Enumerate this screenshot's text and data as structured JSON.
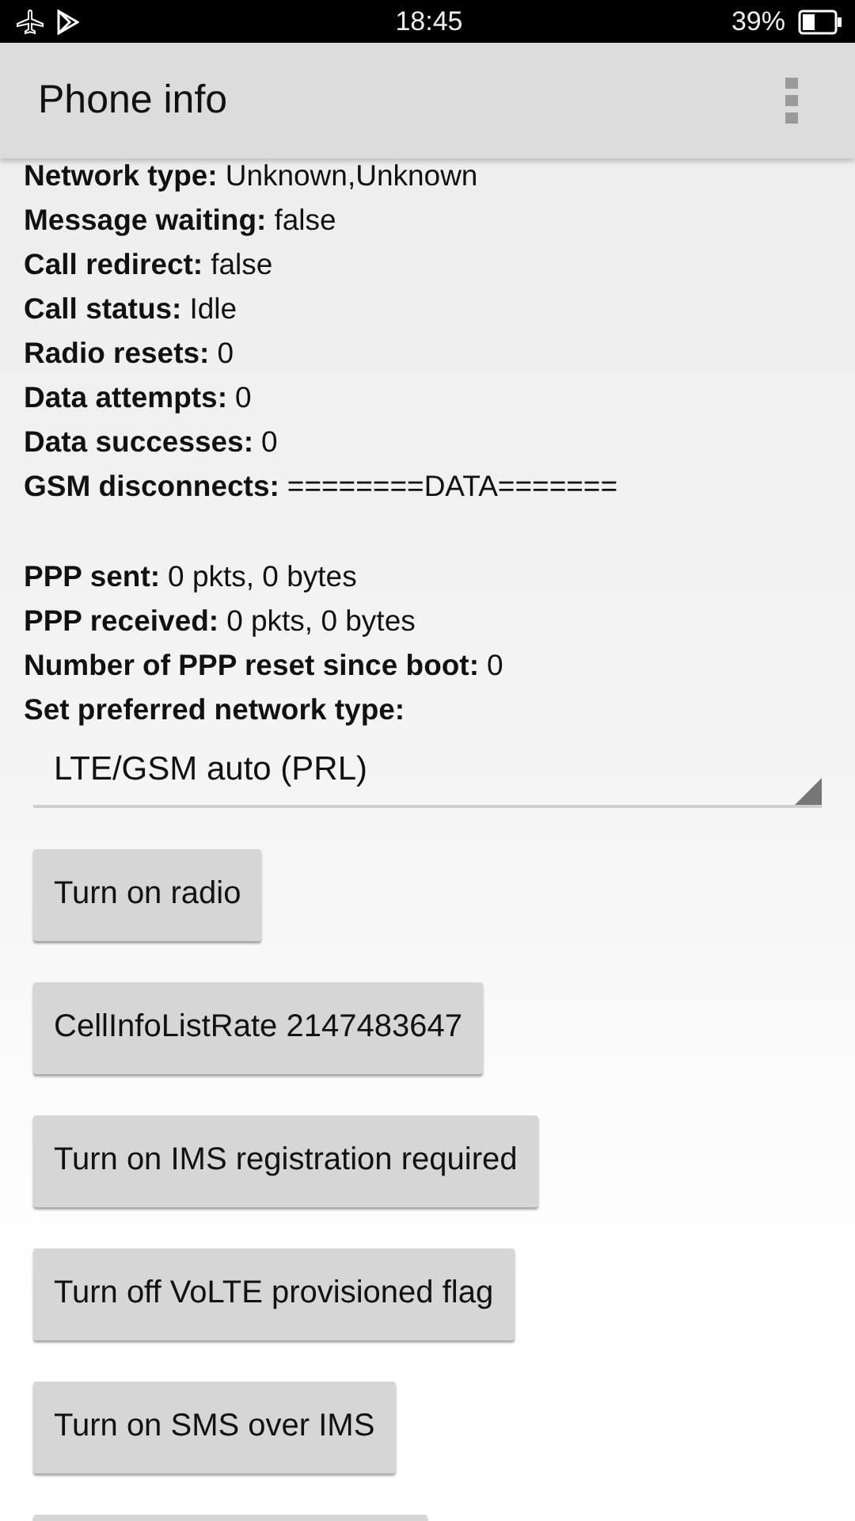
{
  "status_bar": {
    "time": "18:45",
    "battery": "39%"
  },
  "app_bar": {
    "title": "Phone info"
  },
  "info_groups": [
    [
      {
        "label": "Network type:",
        "value": "Unknown,Unknown"
      },
      {
        "label": "Message waiting:",
        "value": "false"
      },
      {
        "label": "Call redirect:",
        "value": "false"
      },
      {
        "label": "Call status:",
        "value": "Idle"
      },
      {
        "label": "Radio resets:",
        "value": "0"
      },
      {
        "label": "Data attempts:",
        "value": "0"
      },
      {
        "label": "Data successes:",
        "value": "0"
      },
      {
        "label": "GSM disconnects:",
        "value": "========DATA======="
      }
    ],
    [
      {
        "label": "PPP sent:",
        "value": "0 pkts, 0 bytes"
      },
      {
        "label": "PPP received:",
        "value": "0 pkts, 0 bytes"
      },
      {
        "label": "Number of PPP reset since boot:",
        "value": "0"
      },
      {
        "label": "Set preferred network type:"
      }
    ]
  ],
  "network_type_dropdown": {
    "value": "LTE/GSM auto (PRL)"
  },
  "buttons": [
    "Turn on radio",
    "CellInfoListRate 2147483647",
    "Turn on IMS registration required",
    "Turn off VoLTE provisioned flag",
    "Turn on SMS over IMS"
  ]
}
